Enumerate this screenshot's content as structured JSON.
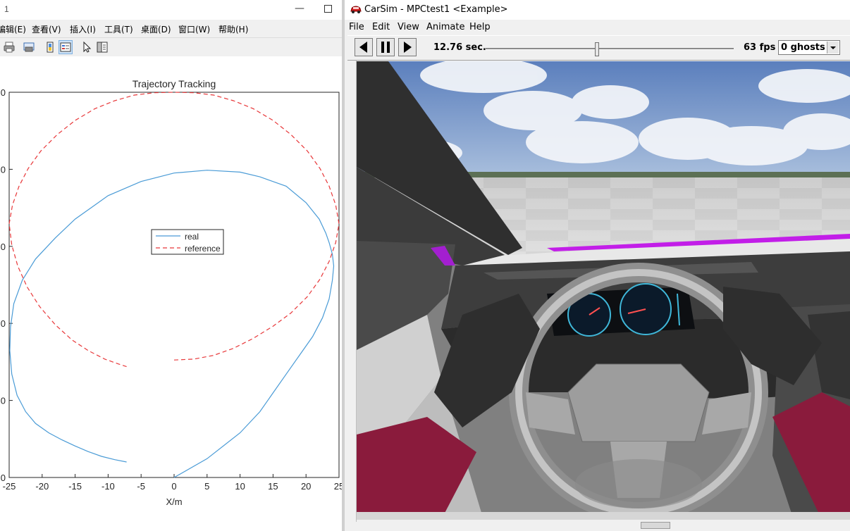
{
  "matlab": {
    "window_title": "1",
    "menu": [
      "编辑(E)",
      "查看(V)",
      "插入(I)",
      "工具(T)",
      "桌面(D)",
      "窗口(W)",
      "帮助(H)"
    ],
    "toolbar_icons": [
      "print-icon",
      "print-preview-icon",
      "colorbar-icon",
      "legend-icon",
      "pointer-icon",
      "property-editor-icon"
    ]
  },
  "chart_data": {
    "type": "line",
    "title": "Trajectory Tracking",
    "xlabel": "X/m",
    "ylabel": "",
    "xlim": [
      -25,
      25
    ],
    "ylim": [
      0,
      50
    ],
    "xticks": [
      "-25",
      "-20",
      "-15",
      "-10",
      "-5",
      "0",
      "5",
      "10",
      "15",
      "20",
      "25"
    ],
    "yticks_visible": [
      "0",
      "0",
      "0",
      "0",
      "0",
      "0"
    ],
    "grid": false,
    "legend_position": "center",
    "series": [
      {
        "name": "real",
        "color": "#4a9bd6",
        "style": "solid",
        "x": [
          0,
          5,
          10,
          13,
          15,
          17,
          19,
          21,
          22.5,
          23.5,
          24,
          24.2,
          24,
          23.5,
          23,
          22,
          20,
          17,
          13,
          10,
          5,
          0,
          -5,
          -10,
          -15,
          -18,
          -21,
          -23,
          -24.3,
          -24.8,
          -24.9,
          -24.6,
          -23.8,
          -22.5,
          -21,
          -19,
          -17,
          -15,
          -13,
          -11,
          -9,
          -7.2
        ],
        "y": [
          0,
          4,
          9.5,
          14,
          18,
          22,
          26,
          30,
          34,
          38,
          42,
          45,
          47.5,
          50,
          52,
          55,
          58.5,
          62,
          64,
          65,
          65.4,
          64.8,
          63,
          60,
          55,
          51,
          46.5,
          42,
          37,
          32,
          27,
          22,
          17.5,
          14,
          11.5,
          9.5,
          8,
          6.7,
          5.5,
          4.5,
          3.8,
          3.3
        ]
      },
      {
        "name": "reference",
        "color": "#e8383a",
        "style": "dashed",
        "x": [
          0,
          3,
          6,
          9,
          12,
          15,
          17.7,
          20.2,
          22.1,
          23.5,
          24.5,
          25,
          24.5,
          23.5,
          22.1,
          20.2,
          17.7,
          15,
          12,
          9,
          6,
          3,
          0,
          -3,
          -6,
          -9,
          -12,
          -15,
          -17.7,
          -20.2,
          -22.1,
          -23.5,
          -24.5,
          -25,
          -24.6,
          -23.7,
          -22.3,
          -20.4,
          -18,
          -15.5,
          -13,
          -10.5,
          -8.5,
          -7.2
        ],
        "y": [
          25,
          25.2,
          26,
          27.5,
          29.6,
          32.2,
          35,
          38.5,
          42.2,
          46,
          50,
          54,
          58,
          62,
          65.8,
          69.5,
          73,
          76,
          78.5,
          80.2,
          81.4,
          81.9,
          82,
          81.9,
          81.4,
          80.2,
          78.5,
          76,
          73,
          69.5,
          65.8,
          62,
          58,
          54,
          49.5,
          45,
          40.6,
          36.4,
          32.5,
          29.3,
          27,
          25.2,
          24.2,
          23.6
        ]
      }
    ]
  },
  "carsim": {
    "window_title": "CarSim - MPCtest1 <Example>",
    "menu": [
      "File",
      "Edit",
      "View",
      "Animate",
      "Help"
    ],
    "time_text": "12.76 sec.",
    "fps_text": "63 fps",
    "ghosts_value": "0 ghosts",
    "playback_position": 0.44,
    "controls": [
      "step-back-icon",
      "pause-icon",
      "play-icon"
    ],
    "colors": {
      "sky": "#6f8fc4",
      "ground": "#d6d6d6",
      "accent_magenta": "#c21ee8",
      "sleeve": "#8a1b3c"
    }
  }
}
